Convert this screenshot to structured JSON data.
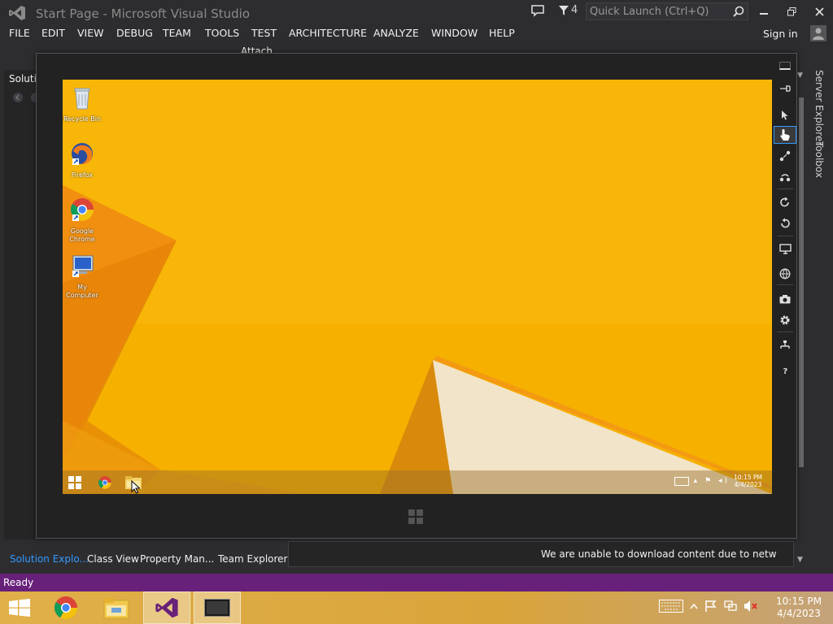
{
  "window": {
    "title": "Start Page - Microsoft Visual Studio",
    "notification_count": "4",
    "quick_launch_placeholder": "Quick Launch (Ctrl+Q)",
    "sign_in": "Sign in"
  },
  "menu": {
    "items": [
      "FILE",
      "EDIT",
      "VIEW",
      "DEBUG",
      "TEAM",
      "TOOLS",
      "TEST",
      "ARCHITECTURE",
      "ANALYZE",
      "WINDOW",
      "HELP"
    ]
  },
  "toolbar": {
    "attach_label": "Attach..."
  },
  "left_panel": {
    "title": "Solution Explorer",
    "tabs": [
      "Solution Explo...",
      "Class View",
      "Property Man...",
      "Team Explorer"
    ]
  },
  "right_tabs": [
    "Server Explorer",
    "Toolbox"
  ],
  "output": {
    "message": "We are unable to download content due to network issues."
  },
  "simulator": {
    "desktop_icons": [
      {
        "label": "Recycle Bin",
        "icon": "recycle-bin-icon"
      },
      {
        "label": "Firefox",
        "icon": "firefox-icon"
      },
      {
        "label": "Google Chrome",
        "icon": "chrome-icon"
      },
      {
        "label": "My Computer",
        "icon": "computer-icon"
      }
    ],
    "time": "10:15 PM",
    "date": "4/4/2023",
    "tools": [
      "pin-icon",
      "pointer-icon",
      "touch-icon",
      "pinch-icon",
      "rotate-touch-icon",
      "rotate-clockwise-icon",
      "rotate-counterclockwise-icon",
      "resolution-icon",
      "location-icon",
      "screenshot-icon",
      "settings-icon",
      "network-icon",
      "help-icon"
    ],
    "active_tool": "touch-icon"
  },
  "status": {
    "text": "Ready"
  },
  "taskbar": {
    "time": "10:15 PM",
    "date": "4/4/2023"
  },
  "colors": {
    "status_bar": "#68217a",
    "accent": "#3399ff",
    "wallpaper": "#f7b400"
  }
}
